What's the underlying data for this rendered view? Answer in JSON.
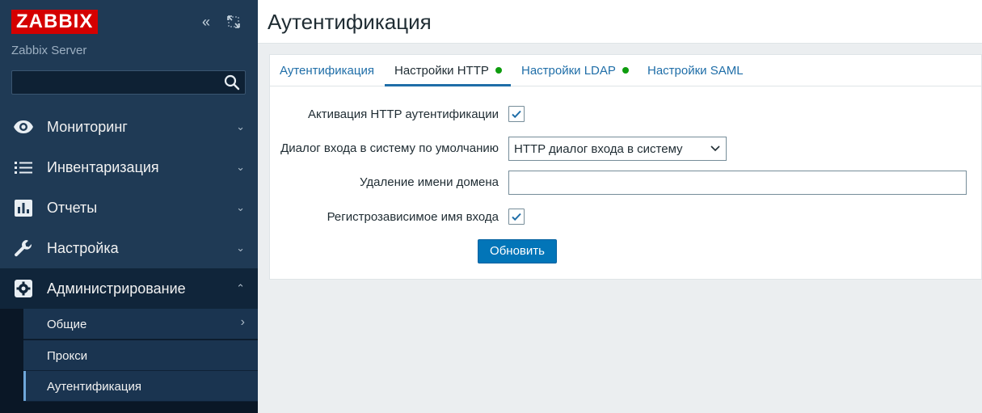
{
  "sidebar": {
    "logo": "ZABBIX",
    "collapse_label": "«",
    "server_name": "Zabbix Server",
    "search": {
      "value": "",
      "placeholder": ""
    },
    "menu": [
      {
        "label": "Мониторинг",
        "icon": "eye-icon",
        "chevron": "⌄"
      },
      {
        "label": "Инвентаризация",
        "icon": "list-icon",
        "chevron": "⌄"
      },
      {
        "label": "Отчеты",
        "icon": "bar-chart-icon",
        "chevron": "⌄"
      },
      {
        "label": "Настройка",
        "icon": "wrench-icon",
        "chevron": "⌄"
      },
      {
        "label": "Администрирование",
        "icon": "gear-icon",
        "chevron": "⌃"
      }
    ],
    "submenu": [
      {
        "label": "Общие",
        "chevron": "›"
      },
      {
        "label": "Прокси"
      },
      {
        "label": "Аутентификация"
      }
    ]
  },
  "page": {
    "title": "Аутентификация"
  },
  "tabs": [
    {
      "label": "Аутентификация"
    },
    {
      "label": "Настройки HTTP"
    },
    {
      "label": "Настройки LDAP"
    },
    {
      "label": "Настройки SAML"
    }
  ],
  "form": {
    "http_enabled": {
      "label": "Активация HTTP аутентификации",
      "checked": true
    },
    "default_login": {
      "label": "Диалог входа в систему по умолчанию",
      "value": "HTTP диалог входа в систему"
    },
    "strip_domain": {
      "label": "Удаление имени домена",
      "value": ""
    },
    "case_sensitive": {
      "label": "Регистрозависимое имя входа",
      "checked": true
    },
    "submit_label": "Обновить"
  },
  "colors": {
    "sidebar_bg": "#1f3a55",
    "logo_bg": "#d40000",
    "link": "#1f6ea8",
    "button": "#0275b8",
    "status_dot": "#0e9c0e"
  }
}
